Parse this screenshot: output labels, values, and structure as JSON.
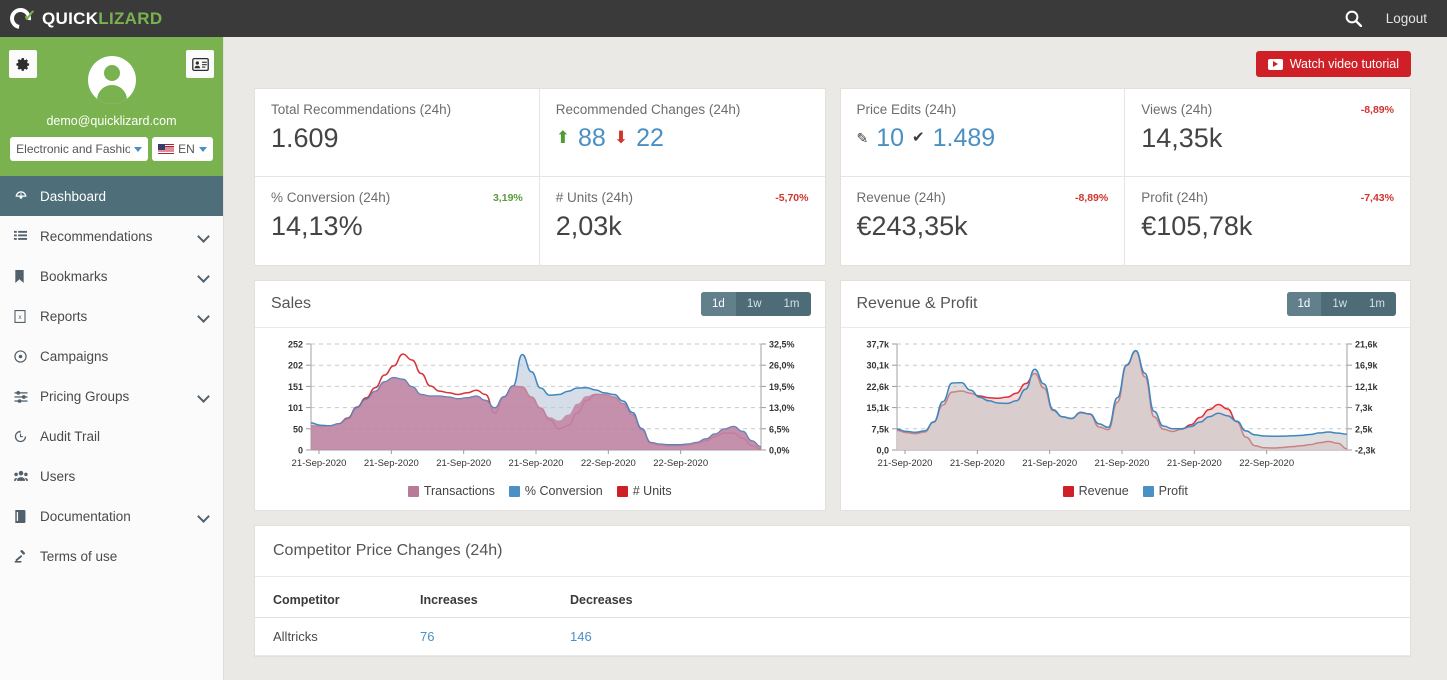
{
  "topbar": {
    "logo_first": "QUICK",
    "logo_second": "LIZARD",
    "search_icon": "search-icon",
    "logout_label": "Logout"
  },
  "sidebar": {
    "settings_icon": "gear-icon",
    "profile_card_icon": "id-card-icon",
    "avatar_icon": "user-avatar-icon",
    "email": "demo@quicklizard.com",
    "account_select": {
      "value": "Electronic and Fashion",
      "caret": "chevron-down-icon"
    },
    "language_select": {
      "value": "EN",
      "flag": "us-flag-icon",
      "caret": "chevron-down-icon"
    },
    "items": [
      {
        "label": "Dashboard",
        "icon": "dashboard-icon",
        "active": true,
        "expandable": false
      },
      {
        "label": "Recommendations",
        "icon": "list-icon",
        "active": false,
        "expandable": true
      },
      {
        "label": "Bookmarks",
        "icon": "bookmark-icon",
        "active": false,
        "expandable": true
      },
      {
        "label": "Reports",
        "icon": "report-icon",
        "active": false,
        "expandable": true
      },
      {
        "label": "Campaigns",
        "icon": "target-icon",
        "active": false,
        "expandable": false
      },
      {
        "label": "Pricing Groups",
        "icon": "sliders-icon",
        "active": false,
        "expandable": true
      },
      {
        "label": "Audit Trail",
        "icon": "history-icon",
        "active": false,
        "expandable": false
      },
      {
        "label": "Users",
        "icon": "users-icon",
        "active": false,
        "expandable": false
      },
      {
        "label": "Documentation",
        "icon": "book-icon",
        "active": false,
        "expandable": true
      },
      {
        "label": "Terms of use",
        "icon": "gavel-icon",
        "active": false,
        "expandable": false
      }
    ]
  },
  "main": {
    "video_button": {
      "label": "Watch video tutorial",
      "icon": "youtube-icon",
      "color": "#cf2027"
    },
    "kpis": [
      {
        "title": "Total Recommendations (24h)",
        "value": "1.609",
        "delta": null,
        "delta_dir": null,
        "type": "single"
      },
      {
        "title": "Recommended Changes (24h)",
        "type": "pair",
        "pair": [
          {
            "icon": "arrow-up-icon",
            "value": "88"
          },
          {
            "icon": "arrow-down-icon",
            "value": "22"
          }
        ]
      },
      {
        "title": "Price Edits (24h)",
        "type": "pair",
        "pair": [
          {
            "icon": "pencil-icon",
            "value": "10"
          },
          {
            "icon": "check-icon",
            "value": "1.489"
          }
        ]
      },
      {
        "title": "Views (24h)",
        "value": "14,35k",
        "delta": "-8,89%",
        "delta_dir": "down",
        "type": "single"
      },
      {
        "title": "% Conversion (24h)",
        "value": "14,13%",
        "delta": "3,19%",
        "delta_dir": "up",
        "type": "single"
      },
      {
        "title": "# Units (24h)",
        "value": "2,03k",
        "delta": "-5,70%",
        "delta_dir": "down",
        "type": "single"
      },
      {
        "title": "Revenue (24h)",
        "value": "€243,35k",
        "delta": "-8,89%",
        "delta_dir": "down",
        "type": "single"
      },
      {
        "title": "Profit (24h)",
        "value": "€105,78k",
        "delta": "-7,43%",
        "delta_dir": "down",
        "type": "single"
      }
    ],
    "range_buttons": [
      {
        "label": "1d",
        "active": true
      },
      {
        "label": "1w",
        "active": false
      },
      {
        "label": "1m",
        "active": false
      }
    ],
    "table": {
      "caption": "Competitor Price Changes (24h)",
      "columns": [
        "Competitor",
        "Increases",
        "Decreases"
      ],
      "rows": [
        {
          "competitor": "Alltricks",
          "increases": "76",
          "decreases": "146"
        }
      ]
    }
  },
  "chart_data": [
    {
      "id": "sales",
      "type": "area",
      "title": "Sales",
      "xlabel": "",
      "ylabel": "",
      "grid": true,
      "legend_position": "bottom",
      "x_ticks": [
        "21-Sep-2020",
        "21-Sep-2020",
        "21-Sep-2020",
        "21-Sep-2020",
        "22-Sep-2020",
        "22-Sep-2020"
      ],
      "y_left_ticks": [
        "0",
        "50",
        "101",
        "151",
        "202",
        "252"
      ],
      "y_left_lim": [
        0,
        252
      ],
      "y_right_ticks": [
        "0,0%",
        "6,5%",
        "13,0%",
        "19,5%",
        "26,0%",
        "32,5%"
      ],
      "y_right_lim": [
        0,
        32.5
      ],
      "series": [
        {
          "name": "Transactions",
          "color": "#b4708f",
          "axis": "left",
          "fill": true,
          "values": [
            58,
            56,
            57,
            62,
            75,
            100,
            120,
            140,
            162,
            172,
            168,
            150,
            132,
            128,
            128,
            126,
            122,
            124,
            128,
            118,
            100,
            126,
            152,
            150,
            126,
            100,
            78,
            70,
            84,
            110,
            128,
            134,
            132,
            126,
            112,
            86,
            50,
            18,
            14,
            12,
            12,
            14,
            18,
            26,
            38,
            50,
            56,
            44,
            22,
            8
          ]
        },
        {
          "name": "% Conversion",
          "color": "#4a90c4",
          "axis": "right",
          "fill": true,
          "values": [
            8.3,
            7.6,
            7.4,
            8.0,
            9.6,
            13.0,
            15.6,
            18.0,
            20.9,
            22.2,
            21.7,
            19.4,
            17.0,
            16.5,
            16.5,
            16.2,
            15.7,
            16.0,
            16.5,
            15.2,
            12.9,
            16.3,
            19.6,
            29.3,
            24.0,
            19.0,
            16.8,
            17.0,
            18.0,
            19.0,
            19.1,
            18.4,
            17.5,
            17.0,
            15.0,
            11.5,
            6.6,
            2.3,
            1.8,
            1.6,
            1.6,
            1.8,
            2.3,
            3.4,
            4.9,
            6.4,
            7.2,
            5.7,
            2.8,
            1.0
          ]
        },
        {
          "name": "# Units",
          "color": "#cf2027",
          "axis": "left",
          "fill": false,
          "values": [
            58,
            56,
            57,
            62,
            76,
            102,
            124,
            148,
            178,
            200,
            228,
            214,
            182,
            152,
            140,
            136,
            132,
            136,
            142,
            132,
            88,
            126,
            152,
            150,
            126,
            100,
            72,
            50,
            58,
            88,
            118,
            132,
            132,
            126,
            110,
            84,
            48,
            16,
            12,
            10,
            10,
            12,
            16,
            22,
            32,
            40,
            40,
            28,
            10,
            2
          ]
        }
      ]
    },
    {
      "id": "revenue_profit",
      "type": "area",
      "title": "Revenue & Profit",
      "xlabel": "",
      "ylabel": "",
      "grid": true,
      "legend_position": "bottom",
      "x_ticks": [
        "21-Sep-2020",
        "21-Sep-2020",
        "21-Sep-2020",
        "21-Sep-2020",
        "21-Sep-2020",
        "22-Sep-2020"
      ],
      "y_left_ticks": [
        "0,0",
        "7,5k",
        "15,1k",
        "22,6k",
        "30,1k",
        "37,7k"
      ],
      "y_left_lim": [
        0,
        37700
      ],
      "y_right_ticks": [
        "-2,3k",
        "2,5k",
        "7,3k",
        "12,1k",
        "16,9k",
        "21,6k"
      ],
      "y_right_lim": [
        -2300,
        21600
      ],
      "series": [
        {
          "name": "Revenue",
          "color": "#cf2027",
          "axis": "left",
          "fill": true,
          "values": [
            7000,
            6200,
            5800,
            6400,
            10000,
            16000,
            20600,
            21000,
            20200,
            19200,
            18600,
            18400,
            18800,
            20200,
            23600,
            27200,
            22000,
            14000,
            11800,
            11200,
            13200,
            12800,
            8200,
            7200,
            17000,
            30000,
            35200,
            26000,
            11800,
            7400,
            6600,
            7400,
            9000,
            11600,
            14400,
            16200,
            14600,
            10000,
            4600,
            1500,
            800,
            700,
            900,
            1200,
            1500,
            1900,
            2600,
            3000,
            2400,
            400
          ]
        },
        {
          "name": "Profit",
          "color": "#4a90c4",
          "axis": "right",
          "fill": true,
          "values": [
            2400,
            1900,
            1700,
            2000,
            4000,
            8600,
            12800,
            12900,
            11200,
            9600,
            8800,
            8300,
            8200,
            8800,
            11400,
            15900,
            12600,
            6800,
            5200,
            4800,
            6200,
            5800,
            3600,
            2800,
            9500,
            16900,
            20100,
            15000,
            6400,
            3100,
            2500,
            2500,
            3000,
            4000,
            5200,
            6000,
            5400,
            4200,
            2000,
            1100,
            850,
            800,
            820,
            900,
            1000,
            1200,
            1550,
            1750,
            1500,
            1250
          ]
        }
      ]
    }
  ]
}
